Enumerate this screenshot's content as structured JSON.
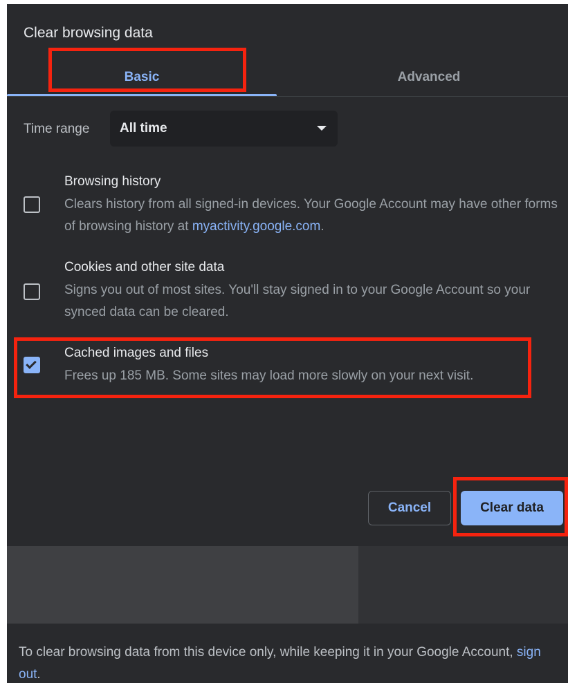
{
  "dialog": {
    "title": "Clear browsing data"
  },
  "tabs": [
    {
      "label": "Basic",
      "selected": true
    },
    {
      "label": "Advanced",
      "selected": false
    }
  ],
  "time_range": {
    "label": "Time range",
    "value": "All time"
  },
  "options": [
    {
      "title": "Browsing history",
      "description": "Clears history from all signed-in devices. Your Google Account may have other forms of browsing history at ",
      "link": "myactivity.google.com",
      "description_end": ".",
      "checked": false
    },
    {
      "title": "Cookies and other site data",
      "description": "Signs you out of most sites. You'll stay signed in to your Google Account so your synced data can be cleared.",
      "checked": false
    },
    {
      "title": "Cached images and files",
      "description": "Frees up 185 MB. Some sites may load more slowly on your next visit.",
      "checked": true
    }
  ],
  "buttons": {
    "cancel": "Cancel",
    "clear": "Clear data"
  },
  "footer": {
    "text": "To clear browsing data from this device only, while keeping it in your Google Account, ",
    "link": "sign out",
    "end": "."
  },
  "colors": {
    "background": "#292a2d",
    "accent": "#8ab4f8",
    "highlight": "#f5230f"
  },
  "icons": [
    "dropdown-arrow-icon",
    "checkmark-icon"
  ]
}
